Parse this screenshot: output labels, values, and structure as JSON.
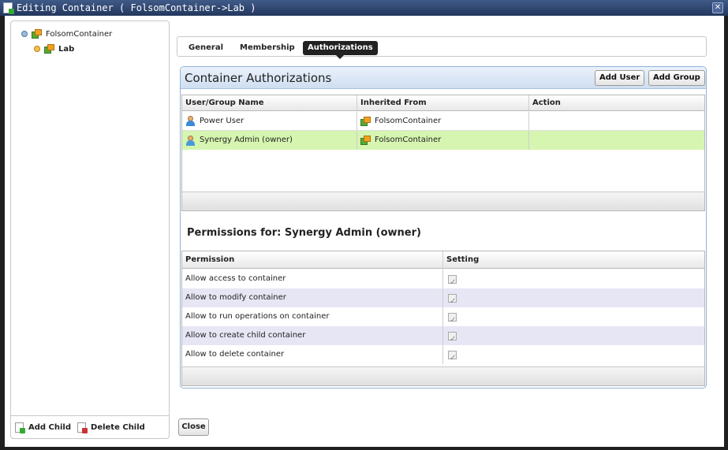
{
  "window": {
    "title": "Editing Container ( FolsomContainer->Lab )",
    "close_glyph": "✕"
  },
  "tree": {
    "root_label": "FolsomContainer",
    "child_label": "Lab",
    "add_child_label": "Add Child",
    "delete_child_label": "Delete Child"
  },
  "tabs": [
    {
      "label": "General"
    },
    {
      "label": "Membership"
    },
    {
      "label": "Authorizations"
    }
  ],
  "authorizations": {
    "title": "Container Authorizations",
    "add_user_label": "Add User",
    "add_group_label": "Add Group",
    "columns": [
      "User/Group Name",
      "Inherited From",
      "Action"
    ],
    "rows": [
      {
        "name": "Power User",
        "inherited": "FolsomContainer",
        "action": "",
        "icon": "group-user-icon"
      },
      {
        "name": "Synergy Admin (owner)",
        "inherited": "FolsomContainer",
        "action": "",
        "icon": "user-icon"
      }
    ]
  },
  "permissions": {
    "title": "Permissions for: Synergy Admin (owner)",
    "columns": [
      "Permission",
      "Setting"
    ],
    "rows": [
      {
        "label": "Allow access to container",
        "checked": true
      },
      {
        "label": "Allow to modify container",
        "checked": true
      },
      {
        "label": "Allow to run operations on container",
        "checked": true
      },
      {
        "label": "Allow to create child container",
        "checked": true
      },
      {
        "label": "Allow to delete container",
        "checked": true
      }
    ]
  },
  "footer": {
    "close_label": "Close"
  },
  "colors": {
    "selected_row": "#d5f5b0",
    "alt_row": "#e6e6f5",
    "title_bar": "#2f4670"
  }
}
